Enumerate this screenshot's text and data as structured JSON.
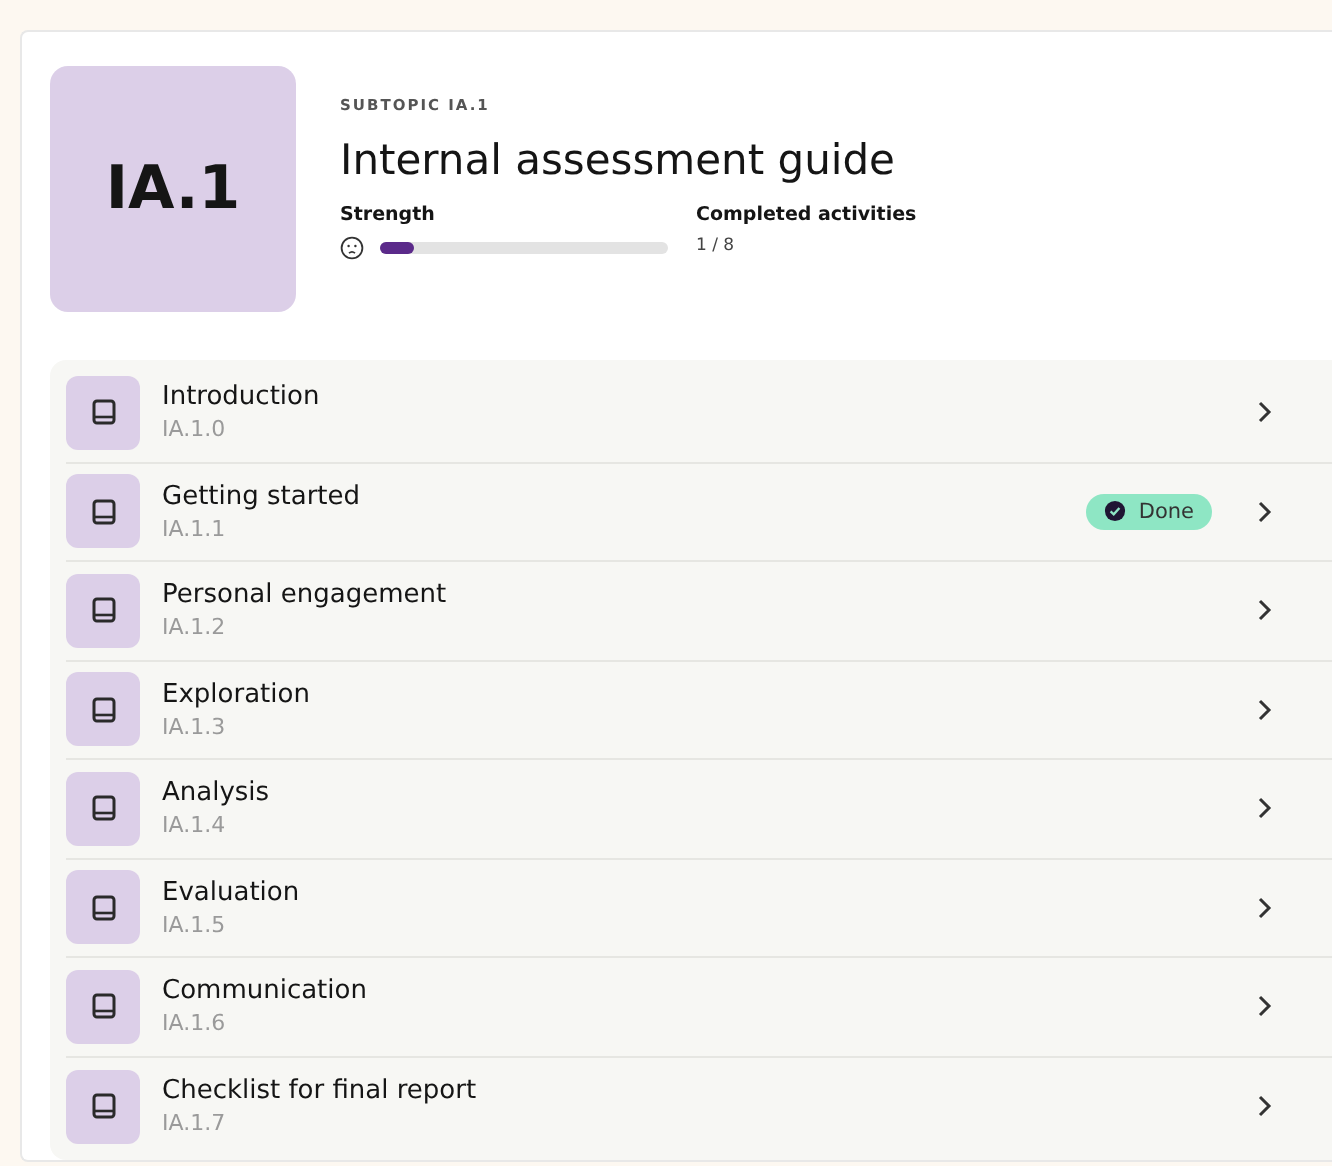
{
  "header": {
    "tile": "IA.1",
    "eyebrow": "SUBTOPIC IA.1",
    "title": "Internal assessment guide",
    "strength": {
      "label": "Strength",
      "level": 0.12
    },
    "completed": {
      "label": "Completed activities",
      "value": "1 / 8"
    }
  },
  "lessons": [
    {
      "title": "Introduction",
      "code": "IA.1.0",
      "done": false
    },
    {
      "title": "Getting started",
      "code": "IA.1.1",
      "done": true,
      "badge": "Done"
    },
    {
      "title": "Personal engagement",
      "code": "IA.1.2",
      "done": false
    },
    {
      "title": "Exploration",
      "code": "IA.1.3",
      "done": false
    },
    {
      "title": "Analysis",
      "code": "IA.1.4",
      "done": false
    },
    {
      "title": "Evaluation",
      "code": "IA.1.5",
      "done": false
    },
    {
      "title": "Communication",
      "code": "IA.1.6",
      "done": false
    },
    {
      "title": "Checklist for final report",
      "code": "IA.1.7",
      "done": false
    }
  ]
}
